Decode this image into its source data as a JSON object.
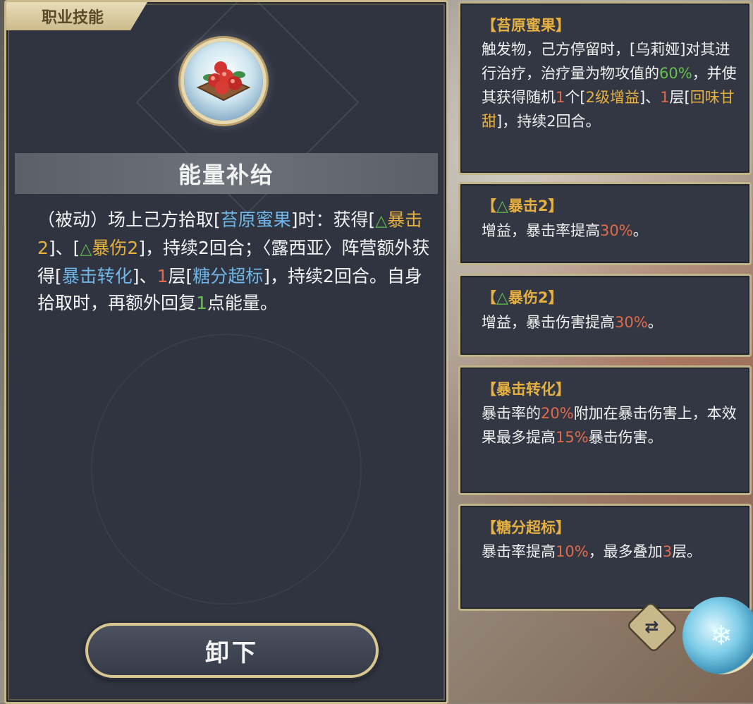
{
  "panel": {
    "tab_label": "职业技能",
    "skill_name": "能量补给",
    "description": {
      "p1": "（被动）场上己方拾取[",
      "item_honeyberry": "苔原蜜果",
      "p2": "]时：获得[",
      "tri_a": "△",
      "buff_crit": "暴击2",
      "p3": "]、[",
      "tri_b": "△",
      "buff_critdmg": "暴伤2",
      "p4": "]，持续2回合；〈露西亚〉阵营额外获得[",
      "buff_convert": "暴击转化",
      "p5": "]、",
      "num_one": "1",
      "p6": "层[",
      "buff_sugar": "糖分超标",
      "p7": "]，持续2回合。自身拾取时，再额外回复",
      "num_energy": "1",
      "p8": "点能量。"
    },
    "unequip_label": "卸下"
  },
  "tooltips": [
    {
      "title": "【苔原蜜果】",
      "body": {
        "a": "触发物，己方停留时，[乌莉娅]对其进行治疗，治疗量为物攻值的",
        "pct": "60%",
        "b": "，并使其获得随机",
        "n1": "1",
        "c": "个[",
        "buff": "2级增益",
        "d": "]、",
        "n2": "1",
        "e": "层[",
        "buff2": "回味甘甜",
        "f": "]，持续2回合。"
      }
    },
    {
      "title_open": "【",
      "title_tri": "△",
      "title_text": "暴击2】",
      "body": {
        "a": "增益，暴击率提高",
        "pct": "30%",
        "b": "。"
      }
    },
    {
      "title_open": "【",
      "title_tri": "△",
      "title_text": "暴伤2】",
      "body": {
        "a": "增益，暴击伤害提高",
        "pct": "30%",
        "b": "。"
      }
    },
    {
      "title": "【暴击转化】",
      "body": {
        "a": "暴击率的",
        "pct1": "20%",
        "b": "附加在暴击伤害上，本效果最多提高",
        "pct2": "15%",
        "c": "暴击伤害。"
      }
    },
    {
      "title": "【糖分超标】",
      "body": {
        "a": "暴击率提高",
        "pct": "10%",
        "b": "，最多叠加",
        "n": "3",
        "c": "层。"
      }
    }
  ],
  "controls": {
    "swap_icon": "swap-arrows-icon",
    "swap_glyph": "⇄",
    "weapon_icon": "snowflake-weapon-icon",
    "weapon_glyph": "❄"
  },
  "colors": {
    "panel_bg": "#2f3440",
    "gold": "#e6b040",
    "blue": "#6fb6e6",
    "red": "#e06a4c",
    "green": "#66c24d",
    "border": "#c9b98a"
  }
}
